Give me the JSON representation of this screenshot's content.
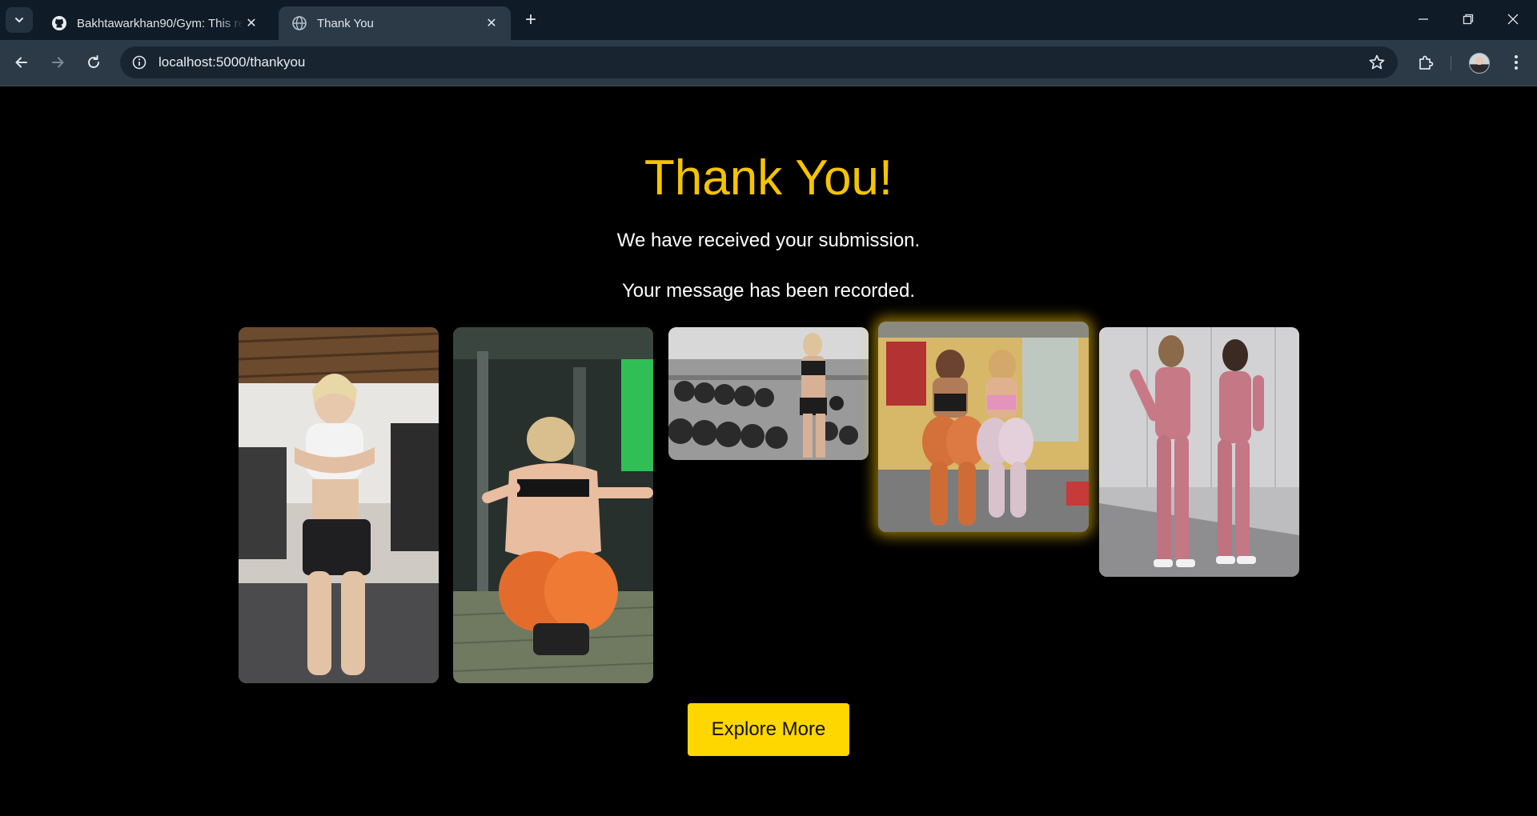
{
  "browser": {
    "tabs": [
      {
        "title": "Bakhtawarkhan90/Gym: This rep",
        "favicon": "github-icon",
        "active": false
      },
      {
        "title": "Thank You",
        "favicon": "globe-icon",
        "active": true
      }
    ],
    "url": "localhost:5000/thankyou"
  },
  "page": {
    "heading": "Thank You!",
    "line1": "We have received your submission.",
    "line2": "Your message has been recorded.",
    "gallery": [
      {
        "alt": "gym-photo-1"
      },
      {
        "alt": "gym-photo-2"
      },
      {
        "alt": "gym-photo-3"
      },
      {
        "alt": "gym-photo-4",
        "highlighted": true
      },
      {
        "alt": "gym-photo-5"
      }
    ],
    "button_label": "Explore More"
  },
  "colors": {
    "accent": "#f5c400",
    "button": "#ffd700",
    "background": "#000000",
    "chrome": "#2c3a48"
  }
}
